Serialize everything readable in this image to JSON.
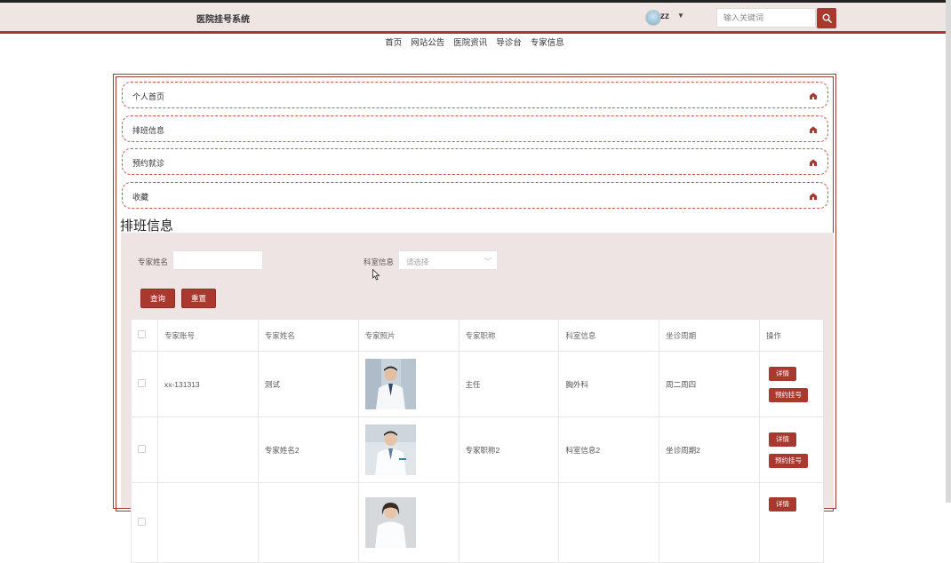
{
  "header": {
    "site_title": "医院挂号系统",
    "username": "zz",
    "search_placeholder": "输入关键词"
  },
  "nav": [
    "首页",
    "网站公告",
    "医院资讯",
    "导诊台",
    "专家信息"
  ],
  "center_menu": [
    "个人首页",
    "排班信息",
    "预约就诊",
    "收藏"
  ],
  "section_title": "排班信息",
  "filters": {
    "expert_name_label": "专家姓名",
    "expert_name_value": "",
    "department_label": "科室信息",
    "department_placeholder": "请选择"
  },
  "buttons": {
    "query": "查询",
    "reset": "重置"
  },
  "table": {
    "headers": [
      "专家账号",
      "专家姓名",
      "专家照片",
      "专家职称",
      "科室信息",
      "坐诊周期",
      "操作"
    ],
    "rows": [
      {
        "account": "xx-131313",
        "name": "测试",
        "title": "主任",
        "department": "胸外科",
        "period": "周二周四"
      },
      {
        "account": "",
        "name": "专家姓名2",
        "title": "专家职称2",
        "department": "科室信息2",
        "period": "坐诊周期2"
      },
      {
        "account": "",
        "name": "",
        "title": "",
        "department": "",
        "period": ""
      }
    ],
    "action_detail": "详情",
    "action_book": "预约挂号"
  },
  "colors": {
    "accent": "#a8392f",
    "header_bg": "#efe6e4",
    "panel_bg": "#eee4e3"
  }
}
